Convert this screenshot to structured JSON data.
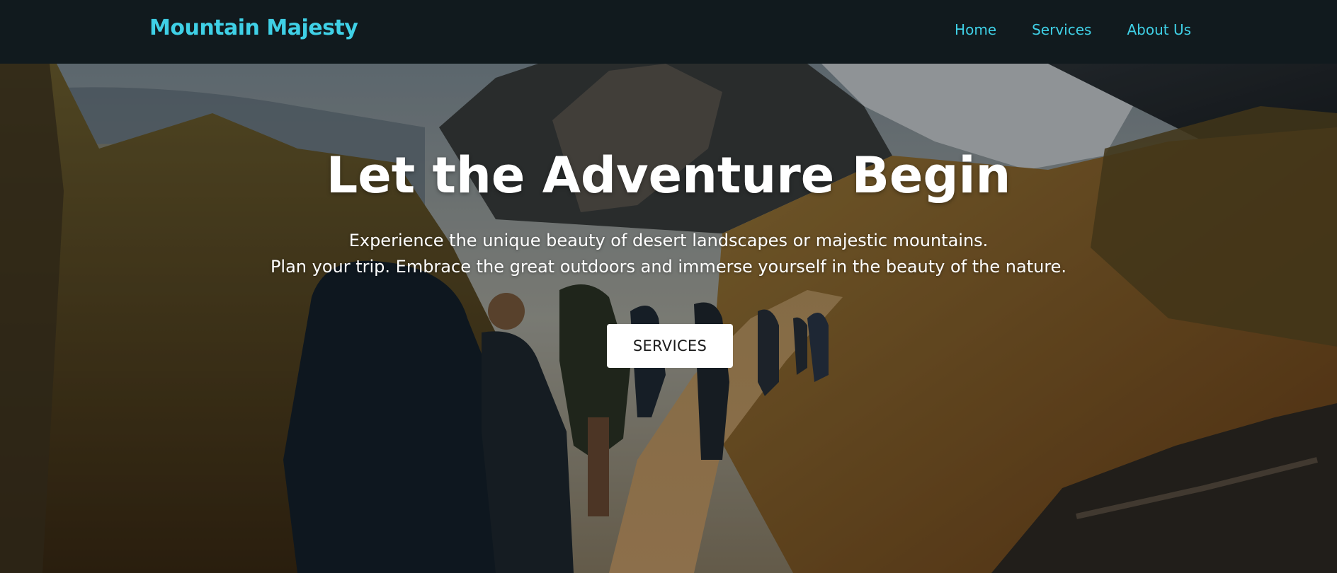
{
  "header": {
    "brand": "Mountain Majesty",
    "nav": [
      {
        "label": "Home"
      },
      {
        "label": "Services"
      },
      {
        "label": "About Us"
      }
    ]
  },
  "hero": {
    "title": "Let the Adventure Begin",
    "subtitle_line1": "Experience the unique beauty of desert landscapes or majestic mountains.",
    "subtitle_line2": "Plan your trip. Embrace the great outdoors and immerse yourself in the beauty of the nature.",
    "cta_label": "SERVICES"
  },
  "colors": {
    "accent": "#3fd0e6",
    "navbar_bg": "#111a1e",
    "button_bg": "#ffffff",
    "hero_text": "#ffffff"
  }
}
